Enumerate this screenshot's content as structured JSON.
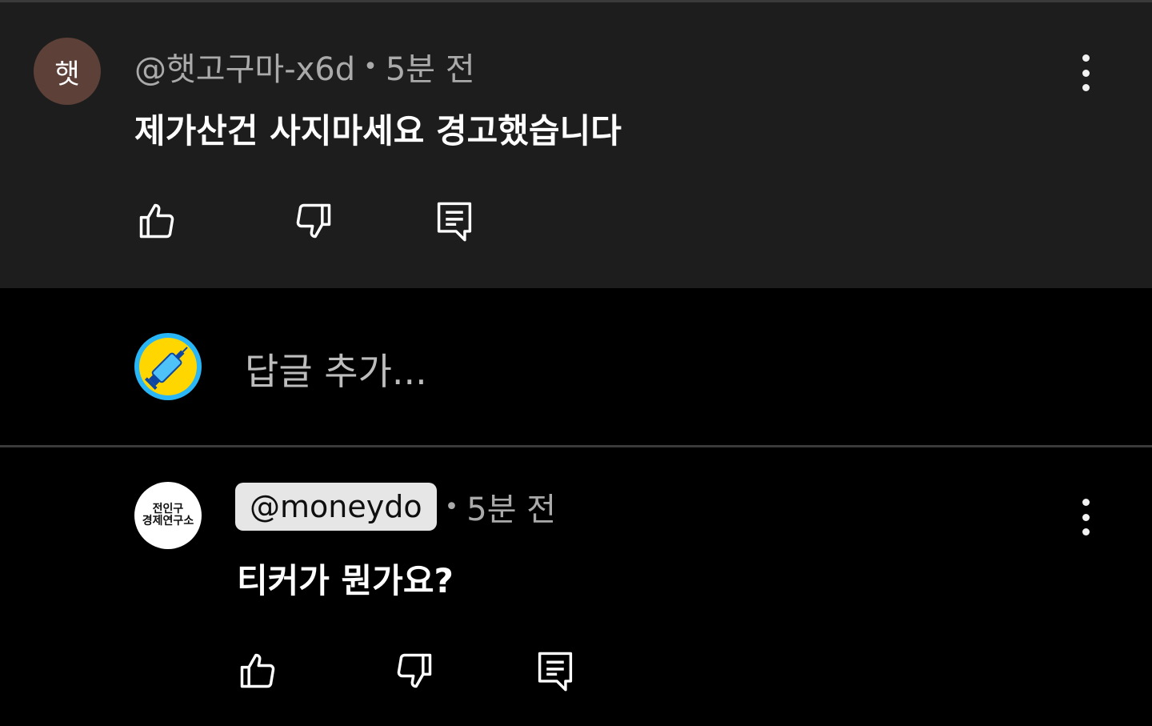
{
  "comments": [
    {
      "avatar_letter": "햇",
      "author": "@햇고구마-x6d",
      "separator": "•",
      "time": "5분 전",
      "text": "제가산건 사지마세요 경고했습니다",
      "avatar_color": "#5d4037"
    },
    {
      "avatar_line1": "전인구",
      "avatar_line2": "경제연구소",
      "author": "@moneydo",
      "separator": "•",
      "time": "5분 전",
      "text": "티커가 뭔가요?"
    }
  ],
  "reply_box": {
    "placeholder": "답글 추가..."
  },
  "icons": {
    "like": "thumbs-up-icon",
    "dislike": "thumbs-down-icon",
    "reply": "comment-icon",
    "more": "more-vert-icon"
  },
  "colors": {
    "background": "#000000",
    "comment_highlight": "#1d1d1d",
    "author_chip": "#e6e6e6",
    "meta_text": "#aaaaaa"
  }
}
